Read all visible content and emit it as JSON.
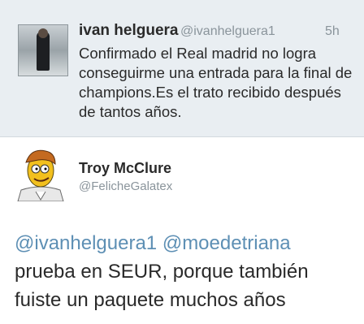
{
  "tweet1": {
    "name": "ivan helguera",
    "handle": "@ivanhelguera1",
    "time": "5h",
    "text": "Confirmado el Real madrid no logra conseguirme una entrada para la final de champions.Es el trato recibido después de tantos años."
  },
  "tweet2": {
    "name": "Troy McClure",
    "handle": "@FelicheGalatex",
    "mention1": "@ivanhelguera1",
    "mention2": "@moedetriana",
    "text": "prueba en SEUR, porque también fuiste un paquete muchos años"
  },
  "colors": {
    "mention": "#5d8fb4",
    "top_background": "#e9eef2"
  }
}
